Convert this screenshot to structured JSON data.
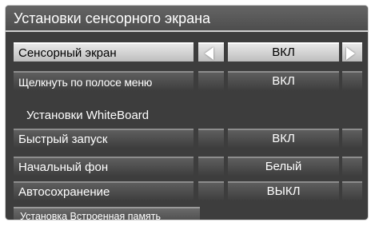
{
  "menu": {
    "title": "Установки сенсорного экрана",
    "rows": [
      {
        "label": "Сенсорный экран",
        "value": "ВКЛ",
        "selected": true
      },
      {
        "label": "Щелкнуть по полосе меню",
        "value": "ВКЛ",
        "selected": false
      },
      {
        "label": "Быстрый запуск",
        "value": "ВКЛ",
        "selected": false
      },
      {
        "label": "Начальный фон",
        "value": "Белый",
        "selected": false
      },
      {
        "label": "Автосохранение",
        "value": "ВЫКЛ",
        "selected": false
      }
    ],
    "section_heading": "Установки WhiteBoard",
    "bottom_button": "Установка  Встроенная память"
  },
  "icons": {
    "left_arrow": "left-triangle-icon",
    "right_arrow": "right-triangle-icon"
  },
  "colors": {
    "panel": "#3d3d3d",
    "selected": "#d6d6d6",
    "text": "#ffffff"
  }
}
